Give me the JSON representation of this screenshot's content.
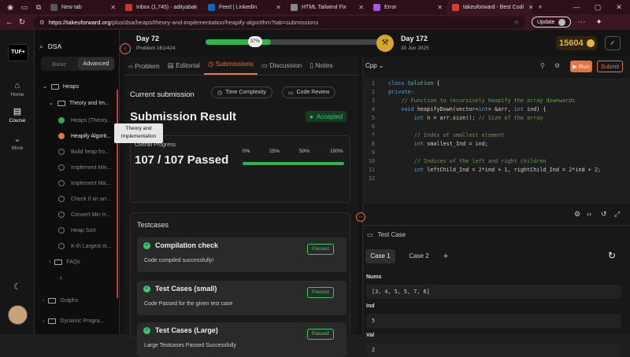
{
  "browser": {
    "tabs": [
      {
        "title": "New tab",
        "color": "#555555"
      },
      {
        "title": "Inbox (1,745) - adityabak",
        "color": "#d93025"
      },
      {
        "title": "Feed | LinkedIn",
        "color": "#0a66c2"
      },
      {
        "title": "HTML Tailwind Fix",
        "color": "#888888"
      },
      {
        "title": "Error",
        "color": "#a855f7"
      },
      {
        "title": "takeuforward - Best Codi",
        "color": "#e53935"
      }
    ],
    "url_host": "https://takeuforward.org",
    "url_path": "/plus/dsa/heaps/theory-and-implementation/heapify-algorithm?tab=submissions",
    "update_label": "Update"
  },
  "rail": {
    "logo": "TUF+",
    "items": [
      {
        "label": "Home",
        "icon": "home-icon"
      },
      {
        "label": "Course",
        "icon": "course-icon"
      },
      {
        "label": "More",
        "icon": "chevron-down-icon"
      }
    ]
  },
  "sidebar": {
    "search_value": "DSA",
    "toggle": {
      "basic": "Basic",
      "advanced": "Advanced"
    },
    "tree": [
      {
        "label": "Heaps",
        "kind": "folder-open",
        "level": 1
      },
      {
        "label": "Theory and Im...",
        "kind": "folder-open",
        "level": 2
      },
      {
        "label": "Heaps (Theory...",
        "kind": "done"
      },
      {
        "label": "Heapify Algorit...",
        "kind": "current"
      },
      {
        "label": "Build heap fro...",
        "kind": "todo"
      },
      {
        "label": "Implement Min...",
        "kind": "todo"
      },
      {
        "label": "Implement Ma...",
        "kind": "todo"
      },
      {
        "label": "Check if an arr...",
        "kind": "todo"
      },
      {
        "label": "Convert Min H...",
        "kind": "todo"
      },
      {
        "label": "Heap Sort",
        "kind": "todo"
      },
      {
        "label": "K-th Largest el...",
        "kind": "todo"
      },
      {
        "label": "FAQs",
        "kind": "folder",
        "level": 2
      },
      {
        "label": "Graphs",
        "kind": "folder",
        "level": 1
      },
      {
        "label": "Dynamic Progra...",
        "kind": "folder",
        "level": 1
      }
    ],
    "tooltip_line1": "Theory and",
    "tooltip_line2": "Implementation"
  },
  "progress": {
    "current_day": "Day 72",
    "problem": "Problem 161/424",
    "percent_label": "37%",
    "percent": 37,
    "target_day": "Day 172",
    "target_date": "30 Jun 2025",
    "coins": "15604"
  },
  "left_panel": {
    "tabs": [
      "Problem",
      "Editorial",
      "Submissions",
      "Discussion",
      "Notes"
    ],
    "active_tab": "Submissions",
    "current_submission": "Current submission",
    "time_complexity": "Time Complexity",
    "code_review": "Code Review",
    "result_title": "Submission Result",
    "status": "Accepted",
    "overall_label": "Overall Progress",
    "overall_value": "107 / 107 Passed",
    "overall_fraction": 1.0,
    "ticks": [
      "0%",
      "25%",
      "50%",
      "100%"
    ],
    "testcases_title": "Testcases",
    "cases": [
      {
        "title": "Compilation check",
        "desc": "Code compiled successfully!",
        "badge": "Passed"
      },
      {
        "title": "Test Cases (small)",
        "desc": "Code Passed for the given test case",
        "badge": "Passed"
      },
      {
        "title": "Test Cases (Large)",
        "desc": "Large Testcases Passed Successfully",
        "badge": "Passed"
      }
    ]
  },
  "right_panel": {
    "language": "Cpp",
    "run": "Run",
    "submit": "Submit",
    "code_lines": [
      "1",
      "2",
      "3",
      "4",
      "5",
      "6",
      "7",
      "8",
      "9",
      "10",
      "11",
      "12"
    ],
    "code": {
      "l1_kw": "class ",
      "l1_ty": "Solution",
      "l1_tx": " {",
      "l2": "private:",
      "l3": "// Function to recursively heapify the array downwards",
      "l4_kw": "void ",
      "l4_fn": "heapifyDown",
      "l4_a": "(vector<",
      "l4_kw2": "int",
      "l4_b": "> &arr, ",
      "l4_kw3": "int",
      "l4_c": " ind) {",
      "l5_kw": "int",
      "l5_a": " n = arr.",
      "l5_fn": "size",
      "l5_b": "(); ",
      "l5_cm": "// Size of the array",
      "l7": "// Index of smallest element",
      "l8_kw": "int",
      "l8_a": " smallest_Ind = ind;",
      "l10": "// Indices of the left and right children",
      "l11_kw": "int",
      "l11_a": " leftChild_Ind = ",
      "l11_n1": "2",
      "l11_b": "*ind + ",
      "l11_n2": "1",
      "l11_c": ", rightChild_Ind = ",
      "l11_n3": "2",
      "l11_d": "*ind + ",
      "l11_n4": "2",
      "l11_e": ";"
    },
    "testcase_title": "Test Case",
    "case1": "Case 1",
    "case2": "Case 2",
    "add": "+",
    "params": [
      {
        "label": "Nums",
        "value": "[3, 4, 5, 5, 7, 6]"
      },
      {
        "label": "Ind",
        "value": "5"
      },
      {
        "label": "Val",
        "value": "2"
      }
    ]
  },
  "colors": {
    "accent": "#e57345",
    "success": "#3ec36b"
  }
}
